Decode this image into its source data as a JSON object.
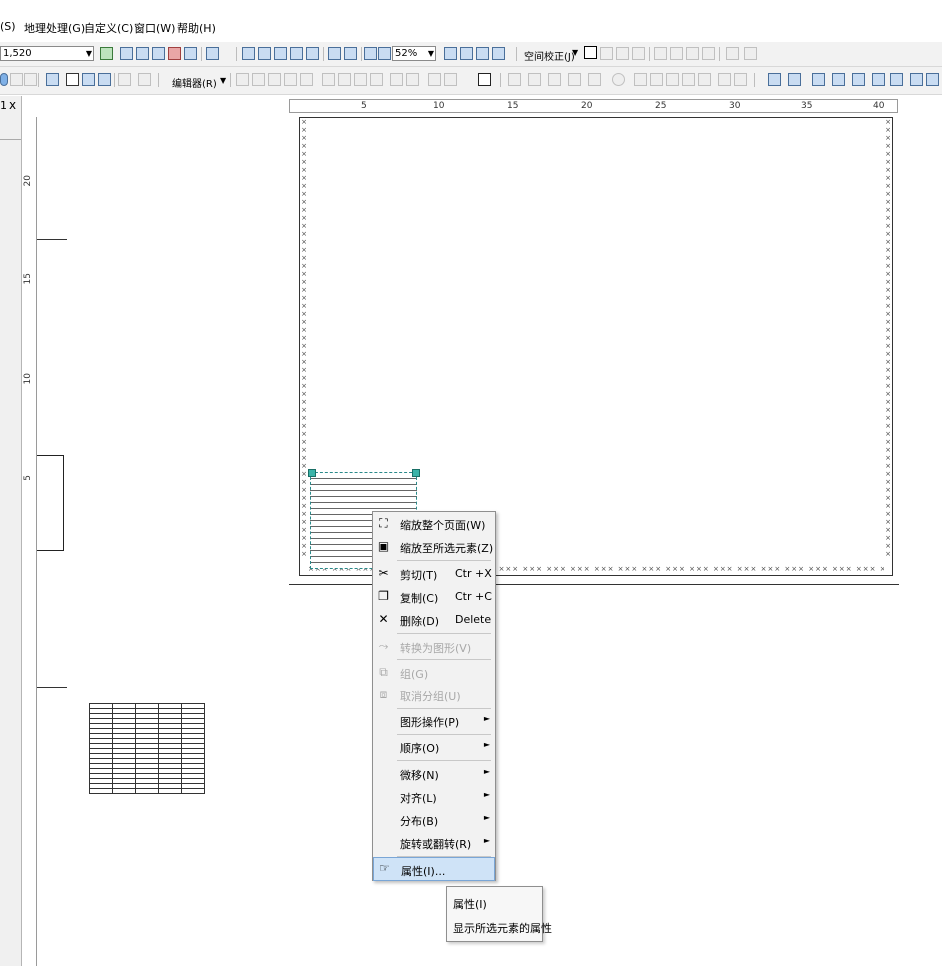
{
  "menubar": {
    "items": [
      "选择(S)",
      "地理处理(G)",
      "自定义(C)",
      "窗口(W)",
      "帮助(H)"
    ],
    "visible_labels": [
      "(S)",
      "地理处理(G)",
      "自定义(C)",
      "窗口(W)",
      "帮助(H)"
    ]
  },
  "toolbar1": {
    "scale_value": "1,520",
    "zoom_value": "52%",
    "spatial_adjust_label": "空间校正(J)"
  },
  "toolbar2": {
    "editor_label": "编辑器(R)"
  },
  "left_panel": {
    "close_glyph": "x",
    "pin_glyph": "1"
  },
  "hruler": {
    "ticks": [
      "5",
      "10",
      "15",
      "20",
      "25",
      "30",
      "35",
      "40"
    ]
  },
  "vruler": {
    "ticks": [
      "20",
      "15",
      "10",
      "5"
    ]
  },
  "context_menu": {
    "items": [
      {
        "label": "缩放整个页面(W)",
        "icon": "zoom-page-icon"
      },
      {
        "label": "缩放至所选元素(Z)",
        "icon": "zoom-selected-icon"
      },
      {
        "label": "剪切(T)",
        "shortcut": "Ctr +X",
        "icon": "scissors-icon"
      },
      {
        "label": "复制(C)",
        "shortcut": "Ctr +C",
        "icon": "copy-icon"
      },
      {
        "label": "删除(D)",
        "shortcut": "Delete",
        "icon": "delete-x-icon"
      },
      {
        "label": "转换为图形(V)",
        "icon": "convert-graphic-icon",
        "disabled": true
      },
      {
        "label": "组(G)",
        "icon": "group-icon",
        "disabled": true
      },
      {
        "label": "取消分组(U)",
        "icon": "ungroup-icon",
        "disabled": true
      },
      {
        "label": "图形操作(P)",
        "submenu": true
      },
      {
        "label": "顺序(O)",
        "submenu": true
      },
      {
        "label": "微移(N)",
        "submenu": true
      },
      {
        "label": "对齐(L)",
        "submenu": true
      },
      {
        "label": "分布(B)",
        "submenu": true
      },
      {
        "label": "旋转或翻转(R)",
        "submenu": true
      },
      {
        "label": "属性(I)...",
        "icon": "properties-icon",
        "highlighted": true
      }
    ]
  },
  "tooltip": {
    "title": "属性(I)",
    "description": "显示所选元素的属性"
  },
  "colors": {
    "menu_highlight": "#cfe3f7",
    "menu_bg": "#f2f2f2",
    "toolbar_bg": "#f2f2f2"
  }
}
